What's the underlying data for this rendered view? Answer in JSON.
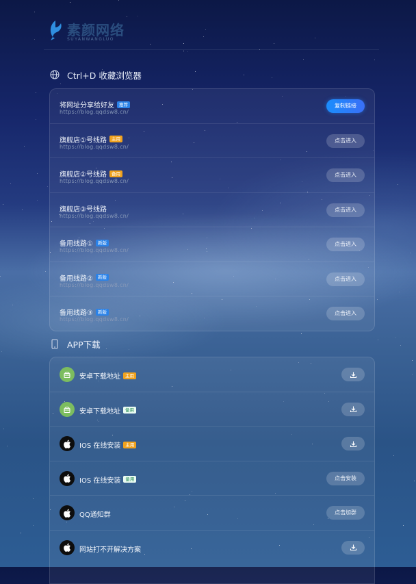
{
  "brand": {
    "name": "素颜网络",
    "sub": "SUYANWANGLUO"
  },
  "favorites": {
    "title": "Ctrl+D 收藏浏览器",
    "items": [
      {
        "title": "将网址分享给好友",
        "badge": "推荐",
        "badge_style": "blue",
        "url": "https://blog.qqdsw8.cn/",
        "button": "复制链接",
        "primary": true
      },
      {
        "title": "旗舰店①号线路",
        "badge": "主用",
        "badge_style": "orange",
        "url": "https://blog.qqdsw8.cn/",
        "button": "点击进入"
      },
      {
        "title": "旗舰店②号线路",
        "badge": "备用",
        "badge_style": "orange",
        "url": "https://blog.qqdsw8.cn/",
        "button": "点击进入"
      },
      {
        "title": "旗舰店③号线路",
        "badge": "",
        "badge_style": "",
        "url": "https://blog.qqdsw8.cn/",
        "button": "点击进入"
      },
      {
        "title": "备用线路①",
        "badge": "新版",
        "badge_style": "blue",
        "url": "https://blog.qqdsw8.cn/",
        "button": "点击进入"
      },
      {
        "title": "备用线路②",
        "badge": "新版",
        "badge_style": "blue",
        "url": "https://blog.qqdsw8.cn/",
        "button": "点击进入"
      },
      {
        "title": "备用线路③",
        "badge": "新版",
        "badge_style": "blue",
        "url": "https://blog.qqdsw8.cn/",
        "button": "点击进入"
      }
    ]
  },
  "apps": {
    "title": "APP下载",
    "items": [
      {
        "title": "安卓下载地址",
        "badge": "主用",
        "badge_style": "orange",
        "icon": "android-icon",
        "button": "",
        "button_icon": "download-icon"
      },
      {
        "title": "安卓下载地址",
        "badge": "备用",
        "badge_style": "green",
        "icon": "android-icon",
        "button": "",
        "button_icon": "download-icon"
      },
      {
        "title": "IOS 在线安装",
        "badge": "主用",
        "badge_style": "orange",
        "icon": "apple-icon",
        "button": "",
        "button_icon": "download-icon"
      },
      {
        "title": "IOS 在线安装",
        "badge": "备用",
        "badge_style": "green",
        "icon": "apple-icon",
        "button": "点击安装",
        "button_icon": ""
      },
      {
        "title": "QQ通知群",
        "badge": "",
        "badge_style": "",
        "icon": "apple-icon",
        "button": "点击加群",
        "button_icon": ""
      },
      {
        "title": "网站打不开解决方案",
        "badge": "",
        "badge_style": "",
        "icon": "apple-icon",
        "button": "",
        "button_icon": "download-icon"
      }
    ]
  },
  "colors": {
    "accent": "#1a8dfc",
    "badge_blue": "#2a82e8",
    "badge_orange": "#f0a21e",
    "android_green": "#7cbd5f"
  }
}
